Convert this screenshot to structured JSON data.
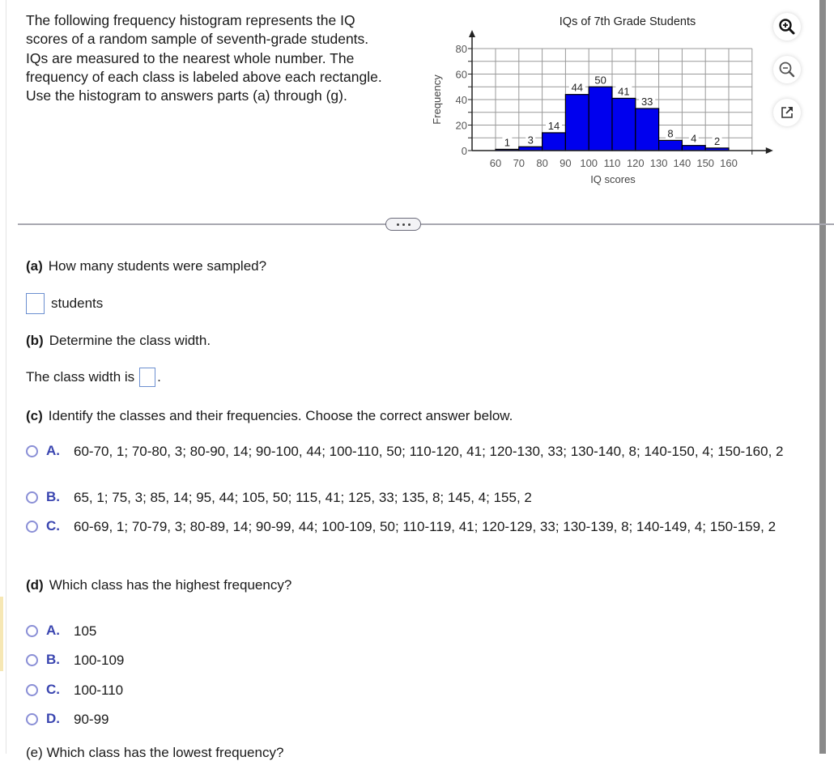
{
  "intro": "The following frequency histogram represents the IQ scores of a random sample of seventh-grade students. IQs are measured to the nearest whole number. The frequency of each class is labeled above each rectangle. Use the histogram to answers parts (a) through (g).",
  "tools": [
    {
      "name": "zoom-in-icon",
      "label": "Zoom in"
    },
    {
      "name": "zoom-out-icon",
      "label": "Zoom out"
    },
    {
      "name": "open-new-window-icon",
      "label": "Open in new window"
    }
  ],
  "chart_data": {
    "type": "bar",
    "title": "IQs of 7th Grade Students",
    "xlabel": "IQ scores",
    "ylabel": "Frequency",
    "bin_edges": [
      60,
      70,
      80,
      90,
      100,
      110,
      120,
      130,
      140,
      150,
      160
    ],
    "categories": [
      "60-70",
      "70-80",
      "80-90",
      "90-100",
      "100-110",
      "110-120",
      "120-130",
      "130-140",
      "140-150",
      "150-160"
    ],
    "values": [
      1,
      3,
      14,
      44,
      50,
      41,
      33,
      8,
      4,
      2
    ],
    "x_ticks": [
      60,
      70,
      80,
      90,
      100,
      110,
      120,
      130,
      140,
      150,
      160
    ],
    "y_ticks": [
      0,
      20,
      40,
      60,
      80
    ],
    "ylim": [
      0,
      80
    ],
    "xlim": [
      50,
      170
    ],
    "grid": true,
    "bar_color": "#0000ee"
  },
  "more_button": "...",
  "part_a": {
    "label": "(a)",
    "question": "How many students were sampled?",
    "unit": "students",
    "value": ""
  },
  "part_b": {
    "label": "(b)",
    "question": "Determine the class width.",
    "prefix": "The class width is",
    "suffix": ".",
    "value": ""
  },
  "part_c": {
    "label": "(c)",
    "question": "Identify the classes and their frequencies. Choose the correct answer below.",
    "options": [
      {
        "letter": "A.",
        "text": "60-70, 1; 70-80, 3; 80-90, 14; 90-100, 44; 100-110, 50; 110-120, 41; 120-130, 33; 130-140, 8; 140-150, 4; 150-160, 2"
      },
      {
        "letter": "B.",
        "text": "65, 1; 75, 3; 85, 14; 95, 44; 105, 50; 115, 41; 125, 33; 135, 8; 145, 4; 155, 2"
      },
      {
        "letter": "C.",
        "text": "60-69, 1; 70-79, 3; 80-89, 14; 90-99, 44; 100-109, 50; 110-119, 41; 120-129, 33; 130-139, 8; 140-149, 4; 150-159, 2"
      }
    ]
  },
  "part_d": {
    "label": "(d)",
    "question": "Which class has the highest frequency?",
    "options": [
      {
        "letter": "A.",
        "text": "105"
      },
      {
        "letter": "B.",
        "text": "100-109"
      },
      {
        "letter": "C.",
        "text": "100-110"
      },
      {
        "letter": "D.",
        "text": "90-99"
      }
    ]
  },
  "part_e_cut": "(e) Which class has the lowest frequency?"
}
